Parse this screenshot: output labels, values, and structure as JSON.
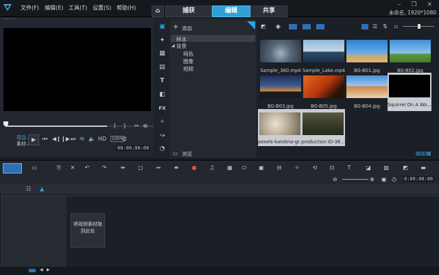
{
  "menubar": {
    "file": "文件(F)",
    "edit": "编辑(E)",
    "tools": "工具(T)",
    "settings": "设置(S)",
    "help": "帮助(H)"
  },
  "tabs": {
    "capture": "捕获",
    "edit": "编辑",
    "share": "共享"
  },
  "window": {
    "controls": "– ❐ ✕",
    "project_info": "未命名, 1920*1080"
  },
  "player": {
    "project_label": "项目—",
    "clip_label": "素材—",
    "hd": "HD",
    "timecode": "00:00:00:00",
    "zoom": "100%"
  },
  "library": {
    "add_label": "添加",
    "tree": {
      "samples": "样本",
      "background": "背景",
      "solid_color": "纯色",
      "image": "图像",
      "video": "视频"
    },
    "browse_label": "浏览",
    "items": [
      {
        "caption": "Sample_360.mp4"
      },
      {
        "caption": "Sample_Lake.mp4"
      },
      {
        "caption": "BG-B01.jpg"
      },
      {
        "caption": "BG-B02.jpg"
      },
      {
        "caption": "BG-B03.jpg"
      },
      {
        "caption": "BG-B05.jpg"
      },
      {
        "caption": "BG-B04.jpg"
      },
      {
        "caption": "Squirrel On A Wo..."
      },
      {
        "caption": "pexels-karolina-gr..."
      },
      {
        "caption": "production ID-38..."
      }
    ]
  },
  "timeline": {
    "timecode": "0:00:00:00",
    "drop_hint": "将视频素材拖到此处"
  },
  "colors": {
    "accent": "#2f9fd8",
    "bg": "#1b1f26"
  }
}
